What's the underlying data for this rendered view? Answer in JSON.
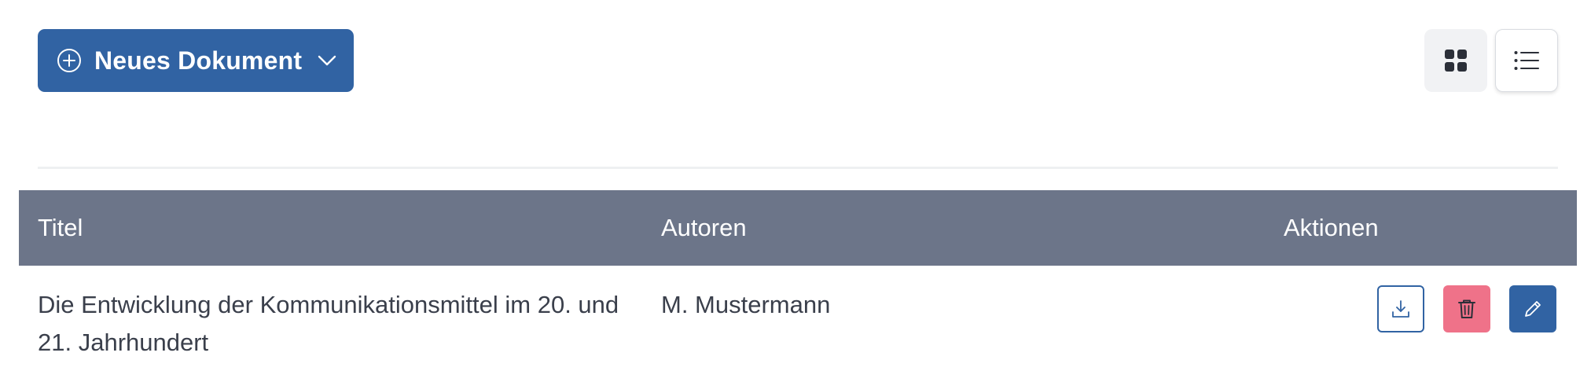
{
  "toolbar": {
    "new_document_label": "Neues Dokument",
    "new_document_icon": "plus-circle-icon",
    "dropdown_icon": "chevron-down-icon",
    "view_grid_icon": "grid-icon",
    "view_list_icon": "list-icon",
    "active_view": "list"
  },
  "table": {
    "columns": [
      "Titel",
      "Autoren",
      "Aktionen"
    ],
    "rows": [
      {
        "title": "Die Entwicklung der Kommunikationsmittel im 20. und 21. Jahrhundert",
        "authors": "M. Mustermann",
        "actions": [
          "download-icon",
          "trash-icon",
          "pencil-icon"
        ]
      }
    ]
  },
  "colors": {
    "primary": "#3163a3",
    "header_bg": "#6c7589",
    "danger": "#ef7289",
    "text": "#3a3f4b"
  }
}
